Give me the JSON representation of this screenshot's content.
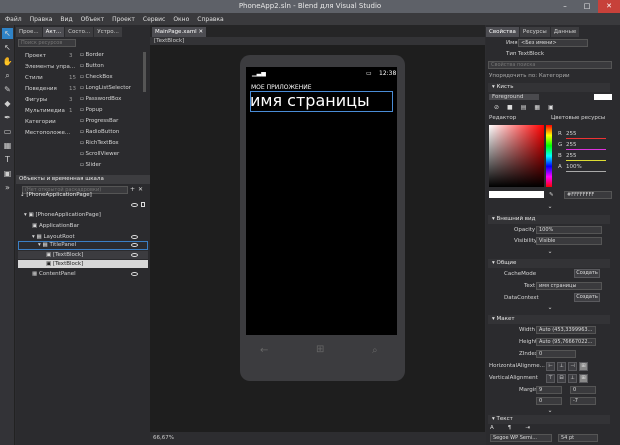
{
  "window": {
    "title": "PhoneApp2.sln - Blend для Visual Studio",
    "btn_min": "–",
    "btn_max": "□",
    "btn_close": "✕"
  },
  "menu": [
    "Файл",
    "Правка",
    "Вид",
    "Объект",
    "Проект",
    "Сервис",
    "Окно",
    "Справка"
  ],
  "left_panel": {
    "tabs": [
      "Прое...",
      "Акт...",
      "Состо...",
      "Устро..."
    ],
    "search_placeholder": "Поиск ресурсов",
    "categories": [
      {
        "label": "Проект",
        "count": "3"
      },
      {
        "label": "Элементы упра...",
        "count": ""
      },
      {
        "label": "Стили",
        "count": "15"
      },
      {
        "label": "Поведения",
        "count": "13"
      },
      {
        "label": "Фигуры",
        "count": "3"
      },
      {
        "label": "Мультимедиа",
        "count": "1"
      },
      {
        "label": "Категории",
        "count": ""
      },
      {
        "label": "Местоположе...",
        "count": ""
      }
    ],
    "controls": [
      "Border",
      "Button",
      "CheckBox",
      "LongListSelector",
      "PasswordBox",
      "Popup",
      "ProgressBar",
      "RadioButton",
      "RichTextBox",
      "ScrollViewer",
      "Slider"
    ]
  },
  "objects_panel": {
    "title": "Объекты и временная шкала",
    "storyboard_placeholder": "(Нет открытой раскадровки)",
    "root": "[PhoneApplicationPage]",
    "tree": [
      {
        "label": "[PhoneApplicationPage]"
      },
      {
        "label": "ApplicationBar"
      },
      {
        "label": "LayoutRoot"
      },
      {
        "label": "TitlePanel"
      },
      {
        "label": "[TextBlock]"
      },
      {
        "label": "[TextBlock]"
      },
      {
        "label": "ContentPanel"
      }
    ]
  },
  "document": {
    "tab": "MainPage.xaml",
    "breadcrumb": "[TextBlock]",
    "zoom": "66,67%",
    "phone": {
      "time": "12:38",
      "app_title": "МОЕ ПРИЛОЖЕНИЕ",
      "page_title": "имя страницы"
    }
  },
  "props": {
    "tabs": [
      "Свойства",
      "Ресурсы",
      "Данные"
    ],
    "name_label": "Имя",
    "name_value": "<Без имени>",
    "type_label": "Тип",
    "type_value": "TextBlock",
    "search_placeholder": "Свойства поиска",
    "arrange": "Упорядочить по: Категории",
    "brush": {
      "section": "Кисть",
      "foreground": "Foreground",
      "editor": "Редактор",
      "color_resources": "Цветовые ресурсы",
      "r": "255",
      "g": "255",
      "b": "255",
      "a": "100%",
      "r_label": "R",
      "g_label": "G",
      "b_label": "B",
      "a_label": "A",
      "hex": "#FFFFFFFF"
    },
    "appearance": {
      "section": "Внешний вид",
      "opacity_label": "Opacity",
      "opacity": "100%",
      "visibility_label": "Visibility",
      "visibility": "Visible"
    },
    "common": {
      "section": "Общие",
      "cachemode_label": "CacheMode",
      "create": "Создать",
      "text_label": "Text",
      "text": "имя страницы",
      "datacontext_label": "DataContext"
    },
    "layout": {
      "section": "Макет",
      "width_label": "Width",
      "width": "Auto (453,3399963...",
      "height_label": "Height",
      "height": "Auto (95,76667022...",
      "zindex_label": "ZIndex",
      "zindex": "0",
      "halign_label": "HorizontalAlignme...",
      "valign_label": "VerticalAlignment",
      "margin_label": "Margin",
      "m_left": "9",
      "m_top": "0",
      "m_right": "0",
      "m_bottom": "-7"
    },
    "text_section": {
      "section": "Текст",
      "font": "Segoe WP Semi...",
      "size": "54 pt"
    }
  },
  "colors": {
    "accent": "#2f83c7",
    "canvas": "#1e1e1e",
    "phone": "#3c3c3f"
  }
}
